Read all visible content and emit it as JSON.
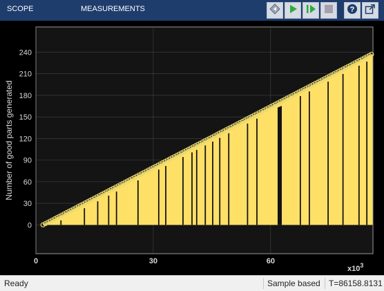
{
  "toolbar": {
    "tabs": [
      {
        "label": "SCOPE"
      },
      {
        "label": "MEASUREMENTS"
      }
    ],
    "buttons": [
      {
        "name": "step-back-icon"
      },
      {
        "name": "run-icon"
      },
      {
        "name": "step-forward-icon"
      },
      {
        "name": "stop-icon"
      },
      {
        "name": "help-icon"
      },
      {
        "name": "undock-icon"
      }
    ]
  },
  "colors": {
    "toolbar_bg": "#1e3d6d",
    "plot_bg": "#141414",
    "series": "#ffe066",
    "marker_edge": "#e8d870",
    "tick_text": "#d9d9d9",
    "grid": "#5a5a5a"
  },
  "chart_data": {
    "type": "line",
    "ylabel": "Number of good parts generated",
    "xlabel": "",
    "x_multiplier_label": "x10",
    "x_multiplier_exponent": "3",
    "xlim": [
      0,
      86.16
    ],
    "ylim": [
      -40,
      275
    ],
    "xticks": [
      "0",
      "30",
      "60"
    ],
    "xtick_values": [
      0,
      30,
      60
    ],
    "yticks": [
      "0",
      "30",
      "60",
      "90",
      "120",
      "150",
      "180",
      "210",
      "240"
    ],
    "ytick_values": [
      0,
      30,
      60,
      90,
      120,
      150,
      180,
      210,
      240
    ],
    "grid": true,
    "series": [
      {
        "style": "stem",
        "x_range": [
          1.8,
          85.8
        ],
        "y_range": [
          0,
          237
        ]
      }
    ],
    "gap_x": [
      6.4,
      12.4,
      15.8,
      18.6,
      20.6,
      26.1,
      31.4,
      33.2,
      37.6,
      39.9,
      41.1,
      43.3,
      45.2,
      47.0,
      49.3,
      54.1,
      56.5,
      62.1,
      62.4,
      62.7,
      67.6,
      69.9,
      74.7,
      78.5,
      82.6,
      84.6
    ]
  },
  "status": {
    "left": "Ready",
    "mode": "Sample based",
    "time": "T=86158.8131"
  }
}
